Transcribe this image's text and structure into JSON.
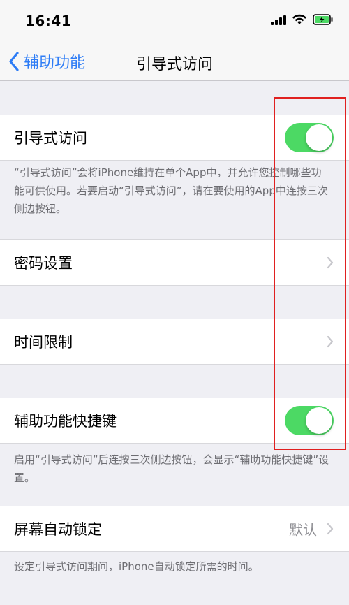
{
  "status_bar": {
    "time": "16:41"
  },
  "nav": {
    "back_label": "辅助功能",
    "title": "引导式访问"
  },
  "guided_access": {
    "label": "引导式访问",
    "toggle_on": true,
    "footer": "“引导式访问”会将iPhone维持在单个App中，并允许您控制哪些功能可供使用。若要启动“引导式访问”，请在要使用的App中连按三次侧边按钮。"
  },
  "passcode": {
    "label": "密码设置"
  },
  "time_limits": {
    "label": "时间限制"
  },
  "accessibility_shortcut": {
    "label": "辅助功能快捷键",
    "toggle_on": true,
    "footer": "启用“引导式访问”后连按三次侧边按钮，会显示“辅助功能快捷键”设置。"
  },
  "auto_lock": {
    "label": "屏幕自动锁定",
    "value": "默认",
    "footer": "设定引导式访问期间，iPhone自动锁定所需的时间。"
  },
  "colors": {
    "accent": "#2d7cf6",
    "toggle_on": "#4cd964",
    "annotation": "#e02020"
  }
}
